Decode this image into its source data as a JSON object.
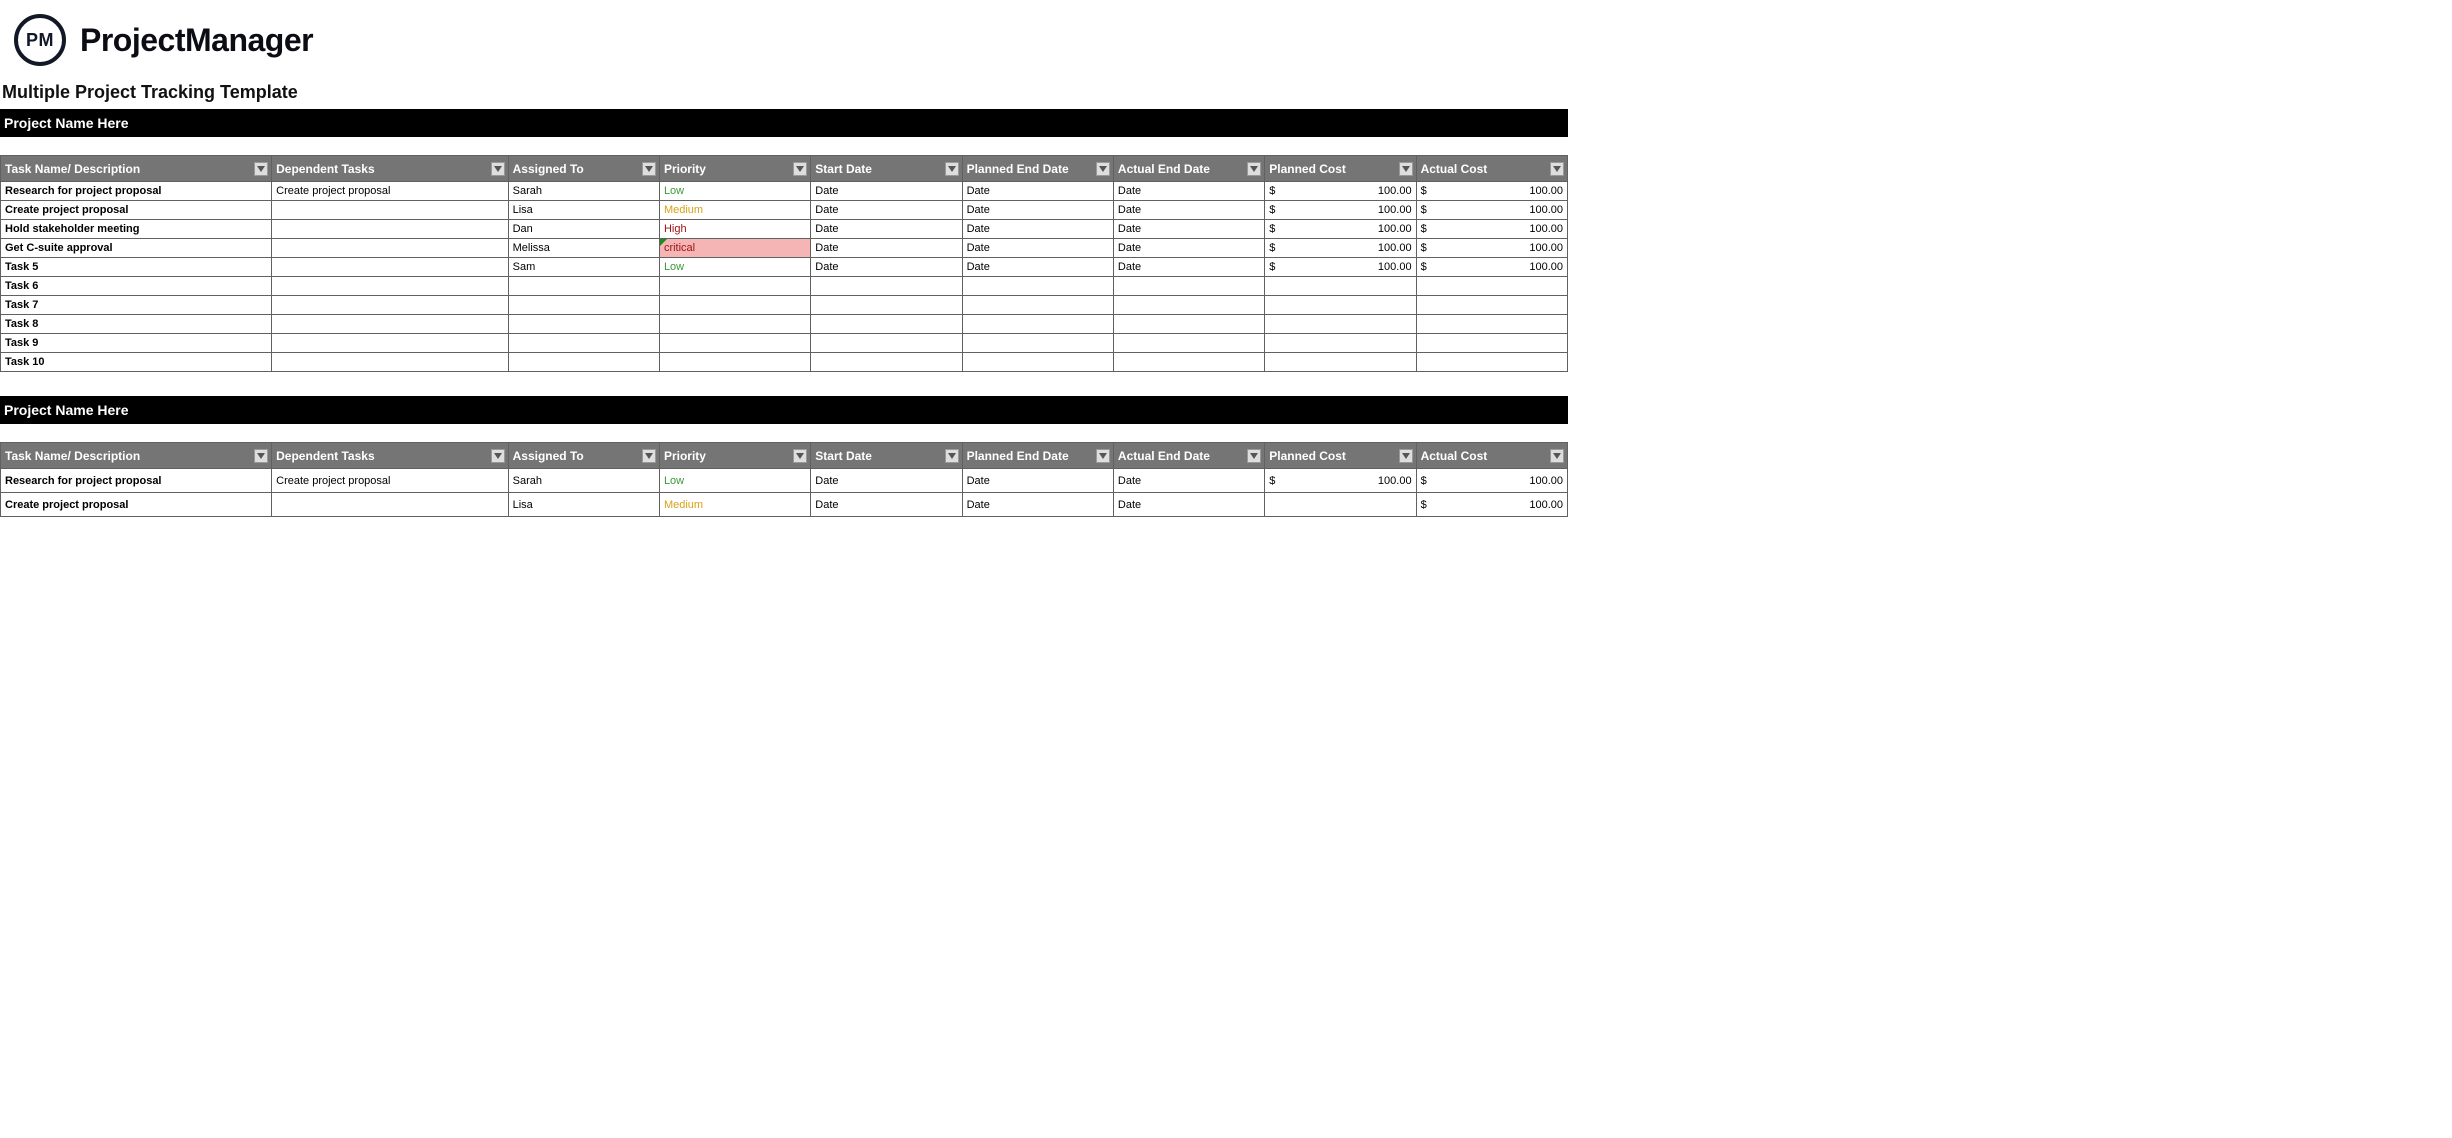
{
  "brand": {
    "logo_initials": "PM",
    "name": "ProjectManager"
  },
  "page_title": "Multiple Project Tracking Template",
  "currency_symbol": "$",
  "columns": {
    "task": "Task Name/ Description",
    "dependent": "Dependent Tasks",
    "assigned": "Assigned To",
    "priority": "Priority",
    "start": "Start Date",
    "planned_end": "Planned End Date",
    "actual_end": "Actual End Date",
    "planned_cost": "Planned Cost",
    "actual_cost": "Actual Cost"
  },
  "projects": [
    {
      "name": "Project Name Here",
      "rows": [
        {
          "task": "Research for project proposal",
          "dependent": "Create project proposal",
          "assigned": "Sarah",
          "priority": "Low",
          "priority_class": "low",
          "start": "Date",
          "planned_end": "Date",
          "actual_end": "Date",
          "planned_cost": "100.00",
          "actual_cost": "100.00"
        },
        {
          "task": "Create project proposal",
          "dependent": "",
          "assigned": "Lisa",
          "priority": "Medium",
          "priority_class": "medium",
          "start": "Date",
          "planned_end": "Date",
          "actual_end": "Date",
          "planned_cost": "100.00",
          "actual_cost": "100.00"
        },
        {
          "task": "Hold stakeholder meeting",
          "dependent": "",
          "assigned": "Dan",
          "priority": "High",
          "priority_class": "high",
          "start": "Date",
          "planned_end": "Date",
          "actual_end": "Date",
          "planned_cost": "100.00",
          "actual_cost": "100.00"
        },
        {
          "task": "Get C-suite approval",
          "dependent": "",
          "assigned": "Melissa",
          "priority": "critical",
          "priority_class": "critical",
          "start": "Date",
          "planned_end": "Date",
          "actual_end": "Date",
          "planned_cost": "100.00",
          "actual_cost": "100.00"
        },
        {
          "task": "Task 5",
          "dependent": "",
          "assigned": "Sam",
          "priority": "Low",
          "priority_class": "low",
          "start": "Date",
          "planned_end": "Date",
          "actual_end": "Date",
          "planned_cost": "100.00",
          "actual_cost": "100.00"
        },
        {
          "task": "Task 6",
          "dependent": "",
          "assigned": "",
          "priority": "",
          "priority_class": "",
          "start": "",
          "planned_end": "",
          "actual_end": "",
          "planned_cost": "",
          "actual_cost": ""
        },
        {
          "task": "Task 7",
          "dependent": "",
          "assigned": "",
          "priority": "",
          "priority_class": "",
          "start": "",
          "planned_end": "",
          "actual_end": "",
          "planned_cost": "",
          "actual_cost": ""
        },
        {
          "task": "Task 8",
          "dependent": "",
          "assigned": "",
          "priority": "",
          "priority_class": "",
          "start": "",
          "planned_end": "",
          "actual_end": "",
          "planned_cost": "",
          "actual_cost": ""
        },
        {
          "task": "Task 9",
          "dependent": "",
          "assigned": "",
          "priority": "",
          "priority_class": "",
          "start": "",
          "planned_end": "",
          "actual_end": "",
          "planned_cost": "",
          "actual_cost": ""
        },
        {
          "task": "Task 10",
          "dependent": "",
          "assigned": "",
          "priority": "",
          "priority_class": "",
          "start": "",
          "planned_end": "",
          "actual_end": "",
          "planned_cost": "",
          "actual_cost": ""
        }
      ]
    },
    {
      "name": "Project Name Here",
      "rows": [
        {
          "task": "Research for project proposal",
          "dependent": "Create project proposal",
          "assigned": "Sarah",
          "priority": "Low",
          "priority_class": "low",
          "start": "Date",
          "planned_end": "Date",
          "actual_end": "Date",
          "planned_cost": "100.00",
          "actual_cost": "100.00"
        },
        {
          "task": "Create project proposal",
          "dependent": "",
          "assigned": "Lisa",
          "priority": "Medium",
          "priority_class": "medium",
          "start": "Date",
          "planned_end": "Date",
          "actual_end": "Date",
          "planned_cost": "",
          "actual_cost": "100.00"
        }
      ]
    }
  ]
}
